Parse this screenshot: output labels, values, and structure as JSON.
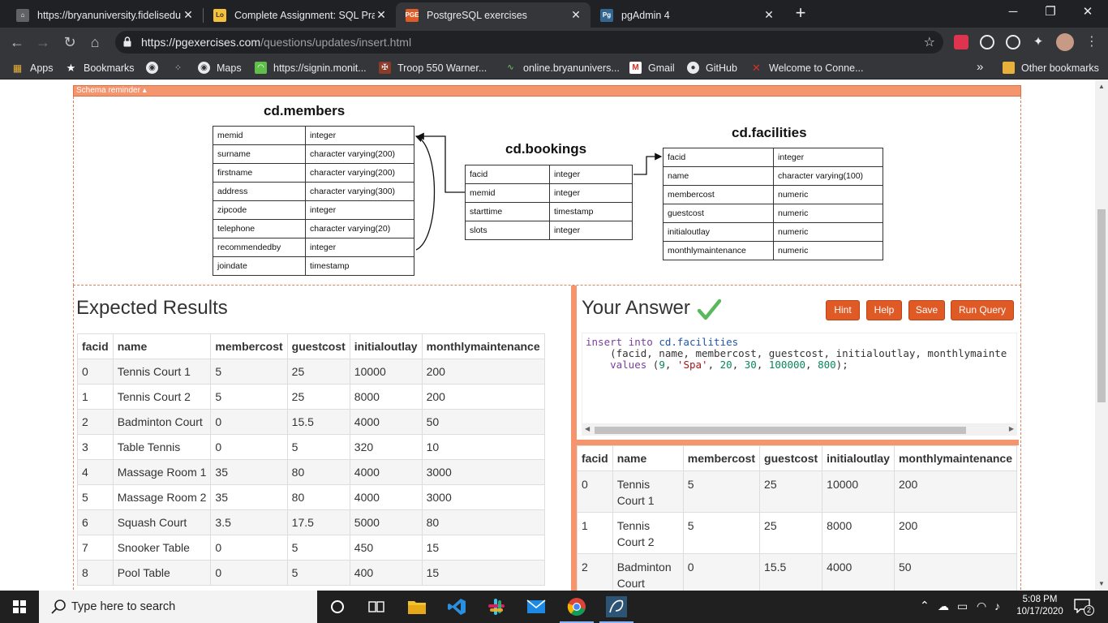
{
  "browser": {
    "tabs": [
      {
        "title": "https://bryanuniversity.fidelisedu",
        "favicon": "fidelis-icon",
        "active": false
      },
      {
        "title": "Complete Assignment: SQL Practi",
        "favicon": "assignment-icon",
        "active": false
      },
      {
        "title": "PostgreSQL exercises",
        "favicon": "pge-icon",
        "active": true
      },
      {
        "title": "pgAdmin 4",
        "favicon": "pgadmin-icon",
        "active": false
      }
    ],
    "new_tab": "+",
    "window_controls": {
      "minimize": "─",
      "maximize": "❐",
      "close": "✕"
    },
    "url_host": "https://pgexercises.com",
    "url_path": "/questions/updates/insert.html",
    "bookmarks": [
      "Apps",
      "Bookmarks",
      "Maps",
      "https://signin.monit...",
      "Troop 550 Warner...",
      "online.bryanunivers...",
      "Gmail",
      "GitHub",
      "Welcome to Conne..."
    ],
    "bookmarks_more": "»",
    "other_bookmarks": "Other bookmarks",
    "accent": "#35363a"
  },
  "schema": {
    "toggle_label": "Schema reminder ▴",
    "members": {
      "title": "cd.members",
      "rows": [
        [
          "memid",
          "integer"
        ],
        [
          "surname",
          "character varying(200)"
        ],
        [
          "firstname",
          "character varying(200)"
        ],
        [
          "address",
          "character varying(300)"
        ],
        [
          "zipcode",
          "integer"
        ],
        [
          "telephone",
          "character varying(20)"
        ],
        [
          "recommendedby",
          "integer"
        ],
        [
          "joindate",
          "timestamp"
        ]
      ]
    },
    "bookings": {
      "title": "cd.bookings",
      "rows": [
        [
          "facid",
          "integer"
        ],
        [
          "memid",
          "integer"
        ],
        [
          "starttime",
          "timestamp"
        ],
        [
          "slots",
          "integer"
        ]
      ]
    },
    "facilities": {
      "title": "cd.facilities",
      "rows": [
        [
          "facid",
          "integer"
        ],
        [
          "name",
          "character varying(100)"
        ],
        [
          "membercost",
          "numeric"
        ],
        [
          "guestcost",
          "numeric"
        ],
        [
          "initialoutlay",
          "numeric"
        ],
        [
          "monthlymaintenance",
          "numeric"
        ]
      ]
    }
  },
  "expected": {
    "title": "Expected Results",
    "columns": [
      "facid",
      "name",
      "membercost",
      "guestcost",
      "initialoutlay",
      "monthlymaintenance"
    ],
    "rows": [
      [
        "0",
        "Tennis Court 1",
        "5",
        "25",
        "10000",
        "200"
      ],
      [
        "1",
        "Tennis Court 2",
        "5",
        "25",
        "8000",
        "200"
      ],
      [
        "2",
        "Badminton Court",
        "0",
        "15.5",
        "4000",
        "50"
      ],
      [
        "3",
        "Table Tennis",
        "0",
        "5",
        "320",
        "10"
      ],
      [
        "4",
        "Massage Room 1",
        "35",
        "80",
        "4000",
        "3000"
      ],
      [
        "5",
        "Massage Room 2",
        "35",
        "80",
        "4000",
        "3000"
      ],
      [
        "6",
        "Squash Court",
        "3.5",
        "17.5",
        "5000",
        "80"
      ],
      [
        "7",
        "Snooker Table",
        "0",
        "5",
        "450",
        "15"
      ],
      [
        "8",
        "Pool Table",
        "0",
        "5",
        "400",
        "15"
      ]
    ]
  },
  "answer": {
    "title": "Your Answer",
    "buttons": {
      "hint": "Hint",
      "help": "Help",
      "save": "Save",
      "run": "Run Query"
    },
    "code": {
      "l1_kw": "insert into",
      "l1_id": "cd.facilities",
      "l2": "    (facid, name, membercost, guestcost, initialoutlay, monthlymainte",
      "l3_kw": "    values",
      "l3_open": " (",
      "v1": "9",
      "c1": ", ",
      "v2": "'Spa'",
      "c2": ", ",
      "v3": "20",
      "c3": ", ",
      "v4": "30",
      "c4": ", ",
      "v5": "100000",
      "c5": ", ",
      "v6": "800",
      "l3_close": ");"
    },
    "columns": [
      "facid",
      "name",
      "membercost",
      "guestcost",
      "initialoutlay",
      "monthlymaintenance"
    ],
    "rows": [
      [
        "0",
        "Tennis Court 1",
        "5",
        "25",
        "10000",
        "200"
      ],
      [
        "1",
        "Tennis Court 2",
        "5",
        "25",
        "8000",
        "200"
      ],
      [
        "2",
        "Badminton Court",
        "0",
        "15.5",
        "4000",
        "50"
      ]
    ],
    "button_color": "#e05a26",
    "check_color": "#5cb85c"
  },
  "taskbar": {
    "search_placeholder": "Type here to search",
    "time": "5:08 PM",
    "date": "10/17/2020",
    "notifications": "2"
  }
}
